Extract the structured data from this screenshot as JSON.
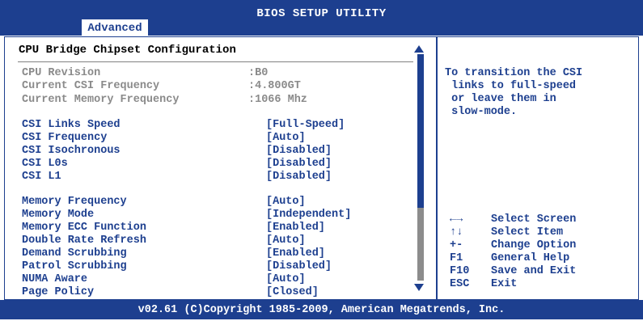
{
  "window": {
    "title": "BIOS SETUP UTILITY",
    "active_tab": "Advanced"
  },
  "section": {
    "title": "CPU Bridge Chipset Configuration"
  },
  "info_rows": [
    {
      "label": "CPU Revision",
      "value": ":B0"
    },
    {
      "label": "Current CSI Frequency",
      "value": ":4.800GT"
    },
    {
      "label": "Current Memory Frequency",
      "value": ":1066 Mhz"
    }
  ],
  "csi_rows": [
    {
      "label": "CSI Links Speed",
      "value": "[Full-Speed]"
    },
    {
      "label": "CSI Frequency",
      "value": "[Auto]"
    },
    {
      "label": "CSI Isochronous",
      "value": "[Disabled]"
    },
    {
      "label": "CSI L0s",
      "value": "[Disabled]"
    },
    {
      "label": "CSI L1",
      "value": "[Disabled]"
    }
  ],
  "memory_rows": [
    {
      "label": "Memory Frequency",
      "value": "[Auto]"
    },
    {
      "label": "Memory Mode",
      "value": "[Independent]"
    },
    {
      "label": "Memory ECC Function",
      "value": "[Enabled]"
    },
    {
      "label": "Double Rate Refresh",
      "value": "[Auto]"
    },
    {
      "label": "Demand Scrubbing",
      "value": "[Enabled]"
    },
    {
      "label": "Patrol Scrubbing",
      "value": "[Disabled]"
    },
    {
      "label": "NUMA Aware",
      "value": "[Auto]"
    },
    {
      "label": "Page Policy",
      "value": "[Closed]"
    }
  ],
  "help": {
    "text": "To transition the CSI\n links to full-speed\n or leave them in\n slow-mode."
  },
  "keys": [
    {
      "key": "←→",
      "desc": "Select Screen"
    },
    {
      "key": "↑↓",
      "desc": "Select Item"
    },
    {
      "key": "+-",
      "desc": "Change Option"
    },
    {
      "key": "F1",
      "desc": "General Help"
    },
    {
      "key": "F10",
      "desc": "Save and Exit"
    },
    {
      "key": "ESC",
      "desc": "Exit"
    }
  ],
  "footer": {
    "text": "v02.61 (C)Copyright 1985-2009, American Megatrends, Inc."
  },
  "colors": {
    "bios_blue": "#1d3f8f",
    "muted_gray": "#8a8a8a",
    "background": "#ffffff"
  }
}
